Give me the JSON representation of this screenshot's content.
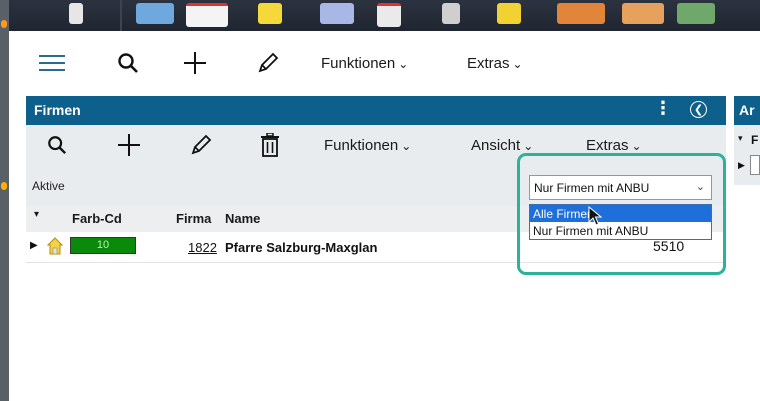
{
  "taskbar": {
    "icons": [
      "app-icon-1",
      "app-icon-2",
      "app-icon-3",
      "app-icon-4",
      "app-icon-5",
      "app-icon-6",
      "app-icon-7",
      "app-icon-8",
      "app-icon-9",
      "app-icon-10",
      "app-icon-11"
    ],
    "colors": {
      "bg": "#1f2530"
    }
  },
  "main_toolbar": {
    "menu_icon": "hamburger-icon",
    "search_icon": "search-icon",
    "add_icon": "plus-icon",
    "edit_icon": "pencil-icon",
    "functions_label": "Funktionen",
    "extras_label": "Extras"
  },
  "firmen_window": {
    "title": "Firmen",
    "toolbar": {
      "functions_label": "Funktionen",
      "view_label": "Ansicht",
      "extras_label": "Extras"
    },
    "status_label": "Aktive",
    "filter": {
      "selected": "Nur Firmen mit ANBU",
      "options": [
        "Alle Firmen",
        "Nur Firmen mit ANBU"
      ],
      "highlighted_option": "Alle Firmen"
    },
    "columns": {
      "color_code": "Farb-Cd",
      "company": "Firma",
      "name": "Name"
    },
    "rows": [
      {
        "color_code": "10",
        "company": "1822",
        "name": "Pfarre Salzburg-Maxglan",
        "extra": "5510"
      }
    ]
  },
  "ar_window": {
    "title_fragment": "Ar",
    "label_fragment": "F"
  },
  "colors": {
    "titlebar": "#0d5f8c",
    "toolbar_bg": "#e9ecef",
    "highlight_ring": "#2bb39a",
    "selection": "#1e6fd9",
    "color_code_green": "#0a8a0a"
  }
}
